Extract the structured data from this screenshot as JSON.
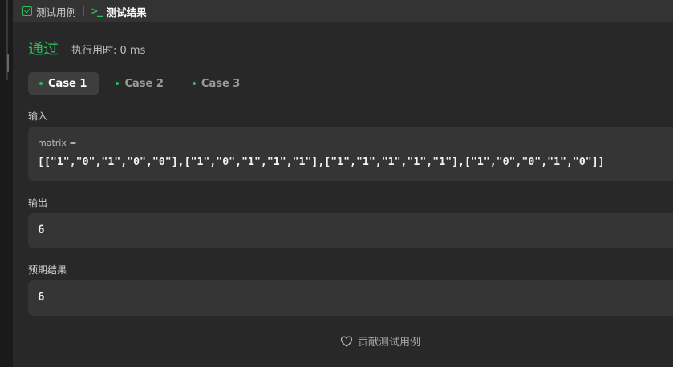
{
  "tabs": [
    {
      "label": "测试用例",
      "icon": "checkbox-icon",
      "active": false
    },
    {
      "label": "测试结果",
      "icon": "terminal-icon",
      "active": true
    }
  ],
  "result": {
    "status": "通过",
    "runtime": "执行用时: 0 ms"
  },
  "cases": [
    {
      "label": "Case 1",
      "active": true
    },
    {
      "label": "Case 2",
      "active": false
    },
    {
      "label": "Case 3",
      "active": false
    }
  ],
  "input": {
    "label": "输入",
    "param_name": "matrix =",
    "param_value": "[[\"1\",\"0\",\"1\",\"0\",\"0\"],[\"1\",\"0\",\"1\",\"1\",\"1\"],[\"1\",\"1\",\"1\",\"1\",\"1\"],[\"1\",\"0\",\"0\",\"1\",\"0\"]]"
  },
  "output": {
    "label": "输出",
    "value": "6"
  },
  "expected": {
    "label": "预期结果",
    "value": "6"
  },
  "contribute": {
    "label": "贡献测试用例",
    "icon": "heart-icon"
  },
  "colors": {
    "accent_green": "#2cbb5d",
    "panel_bg": "#282828",
    "box_bg": "#353535"
  }
}
